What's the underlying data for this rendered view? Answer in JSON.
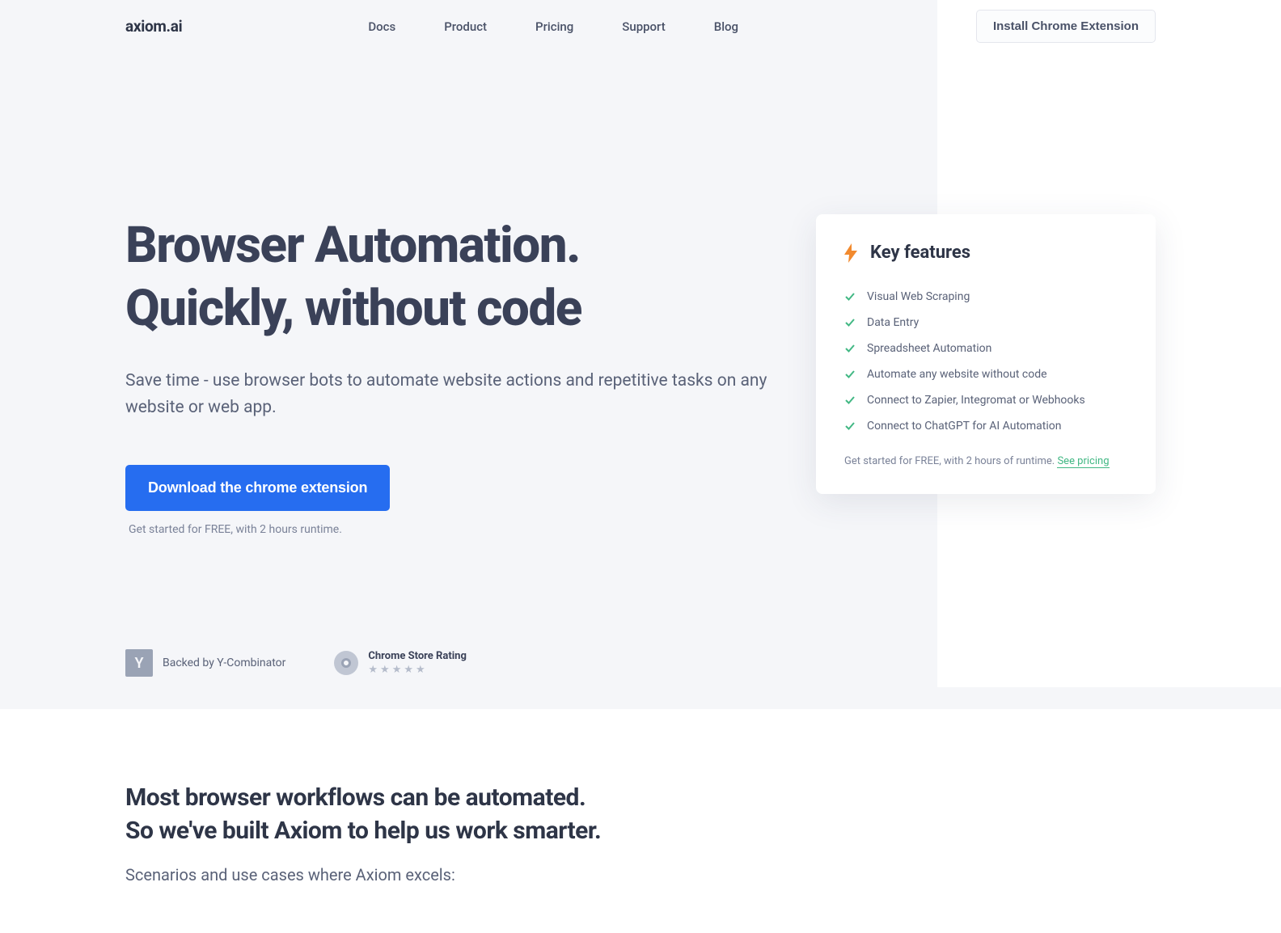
{
  "header": {
    "logo": "axiom.ai",
    "nav": {
      "docs": "Docs",
      "product": "Product",
      "pricing": "Pricing",
      "support": "Support",
      "blog": "Blog"
    },
    "installButton": "Install Chrome Extension"
  },
  "hero": {
    "titleLine1": "Browser Automation.",
    "titleLine2": "Quickly, without code",
    "subtitle": "Save time - use browser bots to automate website actions and repetitive tasks on any website or web app.",
    "downloadButton": "Download the chrome extension",
    "downloadNote": "Get started for FREE, with 2 hours runtime."
  },
  "features": {
    "title": "Key features",
    "items": [
      "Visual Web Scraping",
      "Data Entry",
      "Spreadsheet Automation",
      "Automate any website without code",
      "Connect to Zapier, Integromat or Webhooks",
      "Connect to ChatGPT for AI Automation"
    ],
    "footerText": "Get started for FREE, with 2 hours of runtime. ",
    "seePricing": "See pricing"
  },
  "proof": {
    "ycBadge": "Y",
    "ycText": "Backed by Y-Combinator",
    "chromeLabel": "Chrome Store Rating",
    "stars": "★★★★★"
  },
  "bottom": {
    "titleLine1": "Most browser workflows can be automated.",
    "titleLine2": "So we've built Axiom to help us work smarter.",
    "subtitle": "Scenarios and use cases where Axiom excels:"
  }
}
